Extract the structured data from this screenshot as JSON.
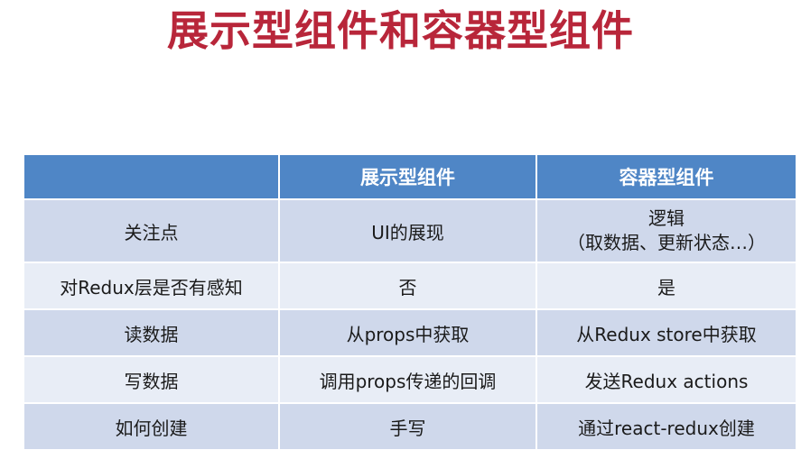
{
  "title": "展示型组件和容器型组件",
  "table": {
    "headers": [
      "",
      "展示型组件",
      "容器型组件"
    ],
    "rows": [
      {
        "label": "关注点",
        "presentational": "UI的展现",
        "container_line1": "逻辑",
        "container_line2": "（取数据、更新状态…）"
      },
      {
        "label": "对Redux层是否有感知",
        "presentational": "否",
        "container": "是"
      },
      {
        "label": "读数据",
        "presentational": "从props中获取",
        "container": "从Redux store中获取"
      },
      {
        "label": "写数据",
        "presentational": "调用props传递的回调",
        "container": "发送Redux actions"
      },
      {
        "label": "如何创建",
        "presentational": "手写",
        "container": "通过react-redux创建"
      }
    ]
  },
  "colors": {
    "title": "#b8263a",
    "header_bg": "#4f86c6",
    "row_dark": "#cfd8eb",
    "row_light": "#e8edf6"
  }
}
